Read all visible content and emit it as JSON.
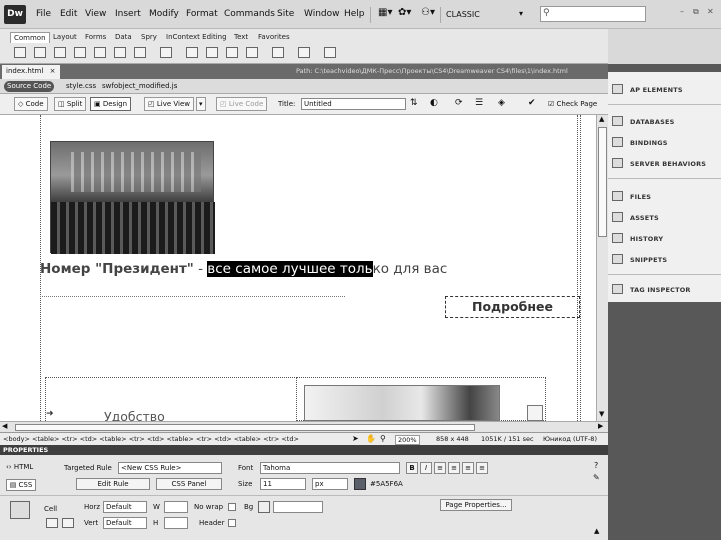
{
  "app": {
    "logo": "Dw",
    "menus": [
      "File",
      "Edit",
      "View",
      "Insert",
      "Modify",
      "Format",
      "Commands",
      "Site",
      "Window",
      "Help"
    ],
    "workspace": "CLASSIC",
    "window_controls": [
      "–",
      "⧉",
      "✕"
    ]
  },
  "insert_tabs": [
    "Common",
    "Layout",
    "Forms",
    "Data",
    "Spry",
    "InContext Editing",
    "Text",
    "Favorites"
  ],
  "doc": {
    "tab": "index.html",
    "path": "Path: C:\\teachvideo\\ДМК-Пресс\\Проекты\\CS4\\Dreamweaver CS4\\files\\1\\index.html",
    "related": [
      "Source Code",
      "style.css",
      "swfobject_modified.js"
    ],
    "view_buttons": [
      "Code",
      "Split",
      "Design",
      "Live View",
      "Live Code"
    ],
    "title_label": "Title:",
    "title_value": "Untitled",
    "check_page": "Check Page"
  },
  "content": {
    "headline_bold": "Номер \"Президент\"",
    "headline_sep": " - ",
    "headline_selected": "все самое лучшее толь",
    "headline_rest": "ко для вас",
    "more_button": "Подробнее",
    "cut_text": "Удобство"
  },
  "status": {
    "tag_path": "<body> <table> <tr> <td> <table> <tr> <td> <table> <tr> <td> <table> <tr> <td>",
    "zoom": "200%",
    "dimensions": "858 x 448",
    "size_time": "1051K / 151 sec",
    "encoding": "Юникод (UTF-8)"
  },
  "properties": {
    "header": "PROPERTIES",
    "html_label": "HTML",
    "css_label": "CSS",
    "targeted_rule_label": "Targeted Rule",
    "targeted_rule_value": "<New CSS Rule>",
    "edit_rule": "Edit Rule",
    "css_panel": "CSS Panel",
    "font_label": "Font",
    "font_value": "Tahoma",
    "size_label": "Size",
    "size_value": "11",
    "size_unit": "px",
    "color_value": "#5A5F6A",
    "cell_label": "Cell",
    "horz_label": "Horz",
    "horz_value": "Default",
    "vert_label": "Vert",
    "vert_value": "Default",
    "w_label": "W",
    "h_label": "H",
    "nowrap_label": "No wrap",
    "header_label": "Header",
    "bg_label": "Bg",
    "page_properties": "Page Properties..."
  },
  "panels": {
    "items": [
      "AP ELEMENTS",
      "DATABASES",
      "BINDINGS",
      "SERVER BEHAVIORS",
      "FILES",
      "ASSETS",
      "HISTORY",
      "SNIPPETS",
      "TAG INSPECTOR"
    ]
  }
}
